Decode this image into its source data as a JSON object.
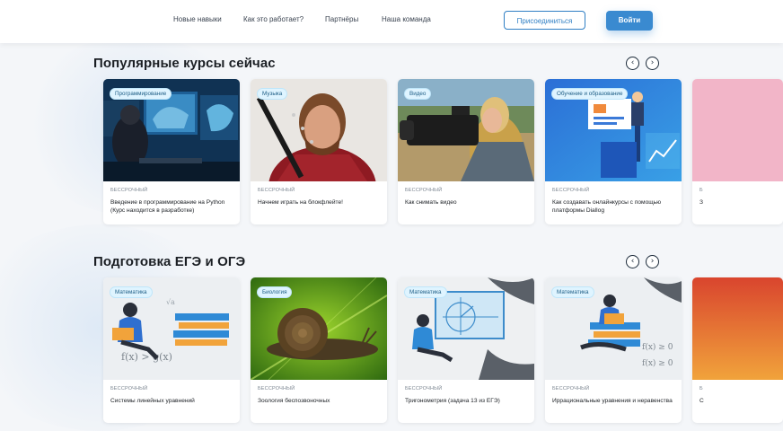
{
  "nav": {
    "links": [
      "Новые навыки",
      "Как это работает?",
      "Партнёры",
      "Наша команда"
    ],
    "join_label": "Присоединиться",
    "login_label": "Войти"
  },
  "sections": [
    {
      "title": "Популярные курсы сейчас",
      "cards": [
        {
          "tag": "Программирование",
          "kind": "БЕССРОЧНЫЙ",
          "title": "Введение в программирование на Python (Курс находится в разработке)"
        },
        {
          "tag": "Музыка",
          "kind": "БЕССРОЧНЫЙ",
          "title": "Начнем играть на блокфлейте!"
        },
        {
          "tag": "Видео",
          "kind": "БЕССРОЧНЫЙ",
          "title": "Как снимать видео"
        },
        {
          "tag": "Обучение и образование",
          "kind": "БЕССРОЧНЫЙ",
          "title": "Как создавать онлайнкурсы с помощью платформы Diallog"
        },
        {
          "tag": "",
          "kind": "Б",
          "title": "З"
        }
      ]
    },
    {
      "title": "Подготовка ЕГЭ и ОГЭ",
      "cards": [
        {
          "tag": "Математика",
          "kind": "БЕССРОЧНЫЙ",
          "title": "Системы линейных уравнений"
        },
        {
          "tag": "Биология",
          "kind": "БЕССРОЧНЫЙ",
          "title": "Зоология беспозвоночных"
        },
        {
          "tag": "Математика",
          "kind": "БЕССРОЧНЫЙ",
          "title": "Тригонометрия (задача 13 из ЕГЭ)"
        },
        {
          "tag": "Математика",
          "kind": "БЕССРОЧНЫЙ",
          "title": "Иррациональные уравнения и неравенства"
        },
        {
          "tag": "",
          "kind": "Б",
          "title": "С"
        }
      ]
    }
  ],
  "arrows": {
    "prev": "‹",
    "next": "›"
  },
  "math_doodles": {
    "a": "f(x) > g(x)",
    "b": "f(x) ≥ 0",
    "c": "√a"
  },
  "colors": {
    "accent": "#3a8ad0",
    "tag_bg": "#dff4ff"
  }
}
